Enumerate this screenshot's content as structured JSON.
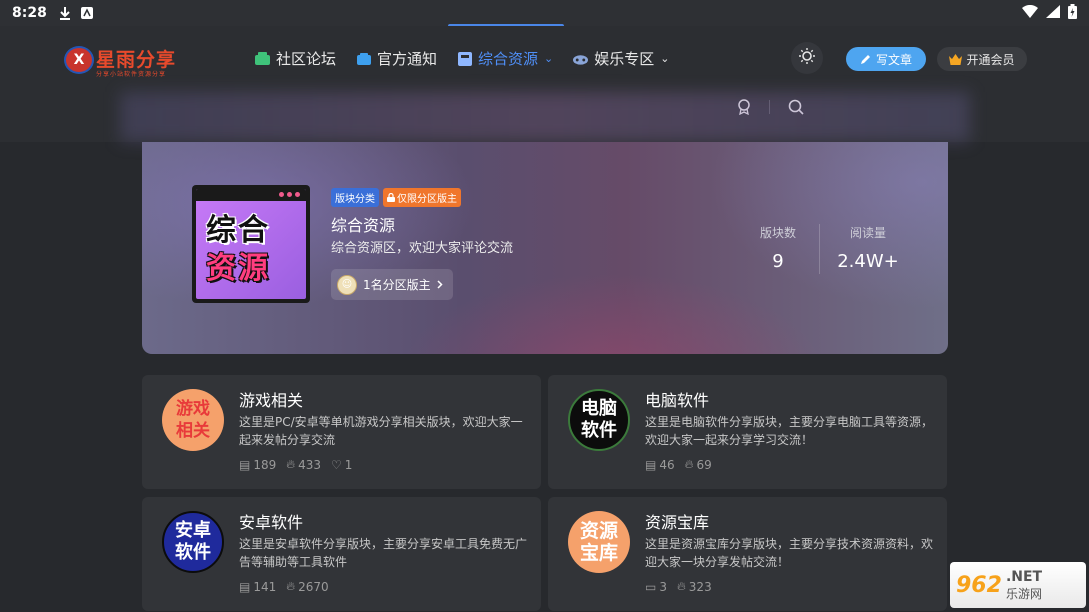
{
  "status_bar": {
    "time": "8:28"
  },
  "header": {
    "logo_text": "星雨分享",
    "logo_sub": "分享小站软件资源分享",
    "nav": [
      {
        "label": "社区论坛",
        "icon": "forum-icon"
      },
      {
        "label": "官方通知",
        "icon": "notice-icon"
      },
      {
        "label": "综合资源",
        "icon": "resource-icon",
        "active": true
      },
      {
        "label": "娱乐专区",
        "icon": "game-icon"
      }
    ],
    "write_label": "写文章",
    "vip_label": "开通会员"
  },
  "banner": {
    "cover_line1": "综合",
    "cover_line2": "资源",
    "badge1": "版块分类",
    "badge2": "仅限分区版主",
    "title": "综合资源",
    "desc": "综合资源区，欢迎大家评论交流",
    "moderators": "1名分区版主",
    "stats": [
      {
        "label": "版块数",
        "value": "9"
      },
      {
        "label": "阅读量",
        "value": "2.4W+"
      }
    ]
  },
  "cards": [
    {
      "icon_l1": "游戏",
      "icon_l2": "相关",
      "title": "游戏相关",
      "desc": "这里是PC/安卓等单机游戏分享相关版块，欢迎大家一起来发帖分享交流",
      "posts": "189",
      "views": "433",
      "likes": "1"
    },
    {
      "icon_l1": "电脑",
      "icon_l2": "软件",
      "title": "电脑软件",
      "desc": "这里是电脑软件分享版块，主要分享电脑工具等资源，欢迎大家一起来分享学习交流！",
      "posts": "46",
      "views": "69"
    },
    {
      "icon_l1": "安卓",
      "icon_l2": "软件",
      "title": "安卓软件",
      "desc": "这里是安卓软件分享版块，主要分享安卓工具免费无广告等辅助等工具软件",
      "posts": "141",
      "views": "2670"
    },
    {
      "icon_l1": "资源",
      "icon_l2": "宝库",
      "title": "资源宝库",
      "desc": "这里是资源宝库分享版块，主要分享技术资源资料，欢迎大家一块分享发帖交流！",
      "comments": "3",
      "views": "323"
    }
  ],
  "watermark": {
    "num": "962",
    "net": ".NET",
    "cn": "乐游网"
  }
}
